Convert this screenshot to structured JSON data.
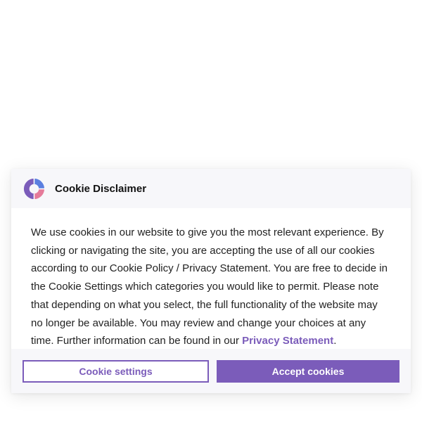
{
  "dialog": {
    "title": "Cookie Disclaimer",
    "logo_icon": "cookie-logo-icon",
    "body_text": "We use cookies in our website to give you the most relevant experience. By clicking or navigating the site, you are accepting the use of all our cookies according to our Cookie Policy / Privacy Statement. You are free to decide in the Cookie Settings which categories you would like to permit. Please note that depending on what you select, the full functionality of the website may no longer be available. You may review and change your choices at any time. Further information can be found in our ",
    "privacy_link": "Privacy Statement",
    "body_end": "."
  },
  "buttons": {
    "settings_label": "Cookie settings",
    "accept_label": "Accept cookies"
  },
  "colors": {
    "accent": "#7b5cba",
    "logo_blue": "#5b7fe0",
    "logo_pink": "#e57b9a",
    "logo_purple": "#7b5cba",
    "header_bg": "#f7f7fa"
  }
}
